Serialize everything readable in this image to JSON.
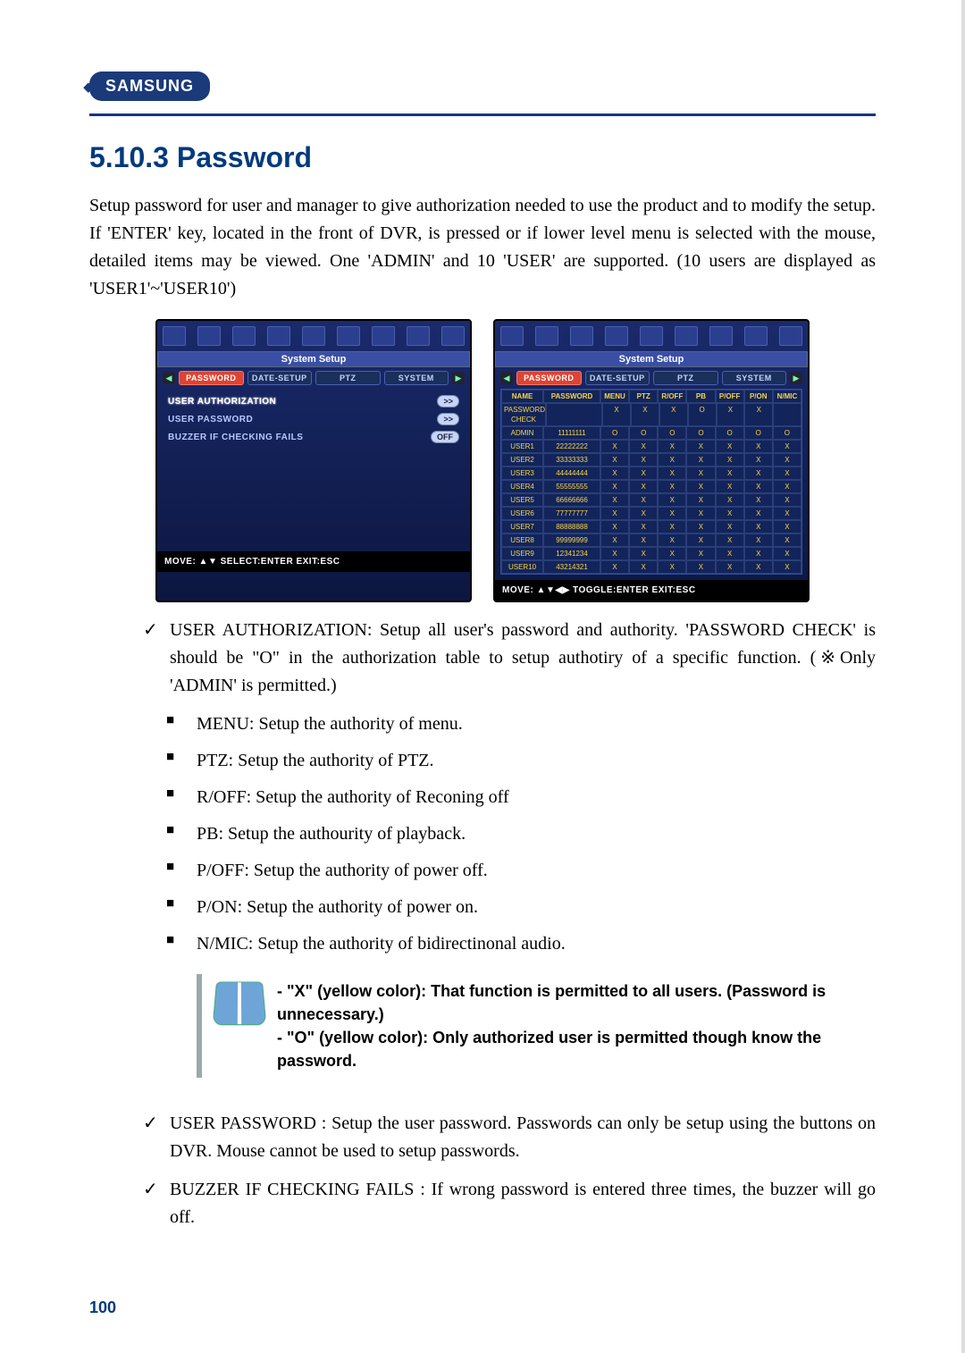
{
  "brand": "SAMSUNG",
  "heading": "5.10.3 Password",
  "intro": "Setup password for user and manager to give authorization needed to use the product and to modify the setup. If 'ENTER' key, located in the front of DVR, is pressed or if lower level menu is selected with the mouse, detailed items may be viewed. One 'ADMIN' and 10 'USER' are supported. (10 users are displayed as 'USER1'~'USER10')",
  "dvr": {
    "title": "System Setup",
    "tabs": [
      "PASSWORD",
      "DATE-SETUP",
      "PTZ",
      "SYSTEM"
    ],
    "left": {
      "items": [
        {
          "label": "USER AUTHORIZATION",
          "val": ">>"
        },
        {
          "label": "USER PASSWORD",
          "val": ">>"
        },
        {
          "label": "BUZZER IF CHECKING FAILS",
          "val": "OFF"
        }
      ],
      "footer": "MOVE: ▲▼    SELECT:ENTER    EXIT:ESC"
    },
    "right": {
      "headers": [
        "NAME",
        "PASSWORD",
        "MENU",
        "PTZ",
        "R/OFF",
        "PB",
        "P/OFF",
        "P/ON",
        "N/MIC"
      ],
      "rows": [
        {
          "n": "PASSWORD CHECK",
          "p": "",
          "c": [
            "X",
            "X",
            "X",
            "O",
            "X",
            "X",
            ""
          ]
        },
        {
          "n": "ADMIN",
          "p": "11111111",
          "c": [
            "O",
            "O",
            "O",
            "O",
            "O",
            "O",
            "O"
          ]
        },
        {
          "n": "USER1",
          "p": "22222222",
          "c": [
            "X",
            "X",
            "X",
            "X",
            "X",
            "X",
            "X"
          ]
        },
        {
          "n": "USER2",
          "p": "33333333",
          "c": [
            "X",
            "X",
            "X",
            "X",
            "X",
            "X",
            "X"
          ]
        },
        {
          "n": "USER3",
          "p": "44444444",
          "c": [
            "X",
            "X",
            "X",
            "X",
            "X",
            "X",
            "X"
          ]
        },
        {
          "n": "USER4",
          "p": "55555555",
          "c": [
            "X",
            "X",
            "X",
            "X",
            "X",
            "X",
            "X"
          ]
        },
        {
          "n": "USER5",
          "p": "66666666",
          "c": [
            "X",
            "X",
            "X",
            "X",
            "X",
            "X",
            "X"
          ]
        },
        {
          "n": "USER6",
          "p": "77777777",
          "c": [
            "X",
            "X",
            "X",
            "X",
            "X",
            "X",
            "X"
          ]
        },
        {
          "n": "USER7",
          "p": "88888888",
          "c": [
            "X",
            "X",
            "X",
            "X",
            "X",
            "X",
            "X"
          ]
        },
        {
          "n": "USER8",
          "p": "99999999",
          "c": [
            "X",
            "X",
            "X",
            "X",
            "X",
            "X",
            "X"
          ]
        },
        {
          "n": "USER9",
          "p": "12341234",
          "c": [
            "X",
            "X",
            "X",
            "X",
            "X",
            "X",
            "X"
          ]
        },
        {
          "n": "USER10",
          "p": "43214321",
          "c": [
            "X",
            "X",
            "X",
            "X",
            "X",
            "X",
            "X"
          ]
        }
      ],
      "footer": "MOVE: ▲▼◀▶ TOGGLE:ENTER    EXIT:ESC"
    }
  },
  "b1": "USER AUTHORIZATION: Setup all user's password and authority. 'PASSWORD CHECK' is should be \"O\" in the authorization table to setup authotiry of a specific function. (※Only 'ADMIN' is permitted.)",
  "sub": {
    "s1": "MENU: Setup the authority of menu.",
    "s2": "PTZ: Setup the authority of PTZ.",
    "s3": "R/OFF: Setup the authority of Reconing off",
    "s4": "PB: Setup the authourity of playback.",
    "s5": "P/OFF: Setup the authority of power off.",
    "s6": "P/ON: Setup the authority of power on.",
    "s7": "N/MIC: Setup the authority of bidirectinonal audio."
  },
  "note1": "- \"X\" (yellow color): That function is permitted to all users. (Password is unnecessary.)",
  "note2": "- \"O\" (yellow color): Only authorized user is permitted though know the password.",
  "b2": "USER PASSWORD : Setup the user password. Passwords can only be setup using the buttons on DVR. Mouse cannot be used to setup passwords.",
  "b3": "BUZZER IF CHECKING FAILS : If wrong password is entered three times, the buzzer will go off.",
  "pageNum": "100"
}
